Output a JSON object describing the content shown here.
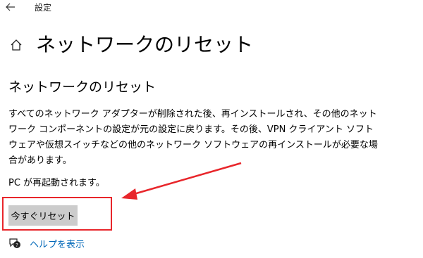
{
  "window": {
    "title": "設定",
    "back_icon": "arrow-left-icon"
  },
  "header": {
    "home_icon": "home-icon",
    "title": "ネットワークのリセット"
  },
  "section": {
    "title": "ネットワークのリセット",
    "description_lines": [
      "すべてのネットワーク アダプターが削除された後、再インストールされ、その他のネット",
      "ワーク コンポーネントの設定が元の設定に戻ります。その後、VPN クライアント ソフト",
      "ウェアや仮想スイッチなどの他のネットワーク ソフトウェアの再インストールが必要な場",
      "合があります。"
    ],
    "restart_note": "PC が再起動されます。"
  },
  "reset_button": {
    "label": "今すぐリセット"
  },
  "help": {
    "icon": "help-chat-icon",
    "link_label": "ヘルプを表示"
  },
  "colors": {
    "accent_link": "#0067b8",
    "button_bg": "#cccccc",
    "annotation_red": "#e8262b"
  }
}
